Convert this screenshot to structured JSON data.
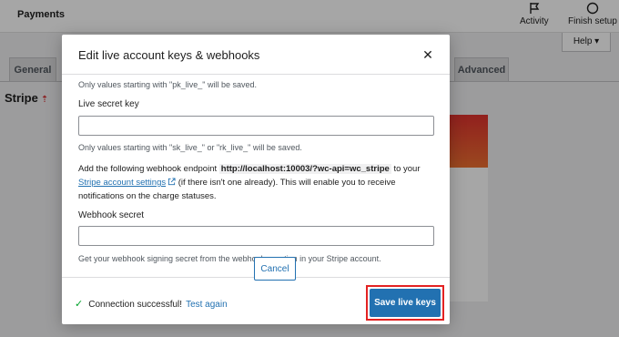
{
  "page": {
    "title": "Payments",
    "activity_label": "Activity",
    "finish_setup_label": "Finish setup",
    "help_label": "Help ▾",
    "tabs": [
      {
        "label": "General"
      },
      {
        "label": "Advanced"
      }
    ],
    "section_heading": "Stripe"
  },
  "modal": {
    "title": "Edit live account keys & webhooks",
    "publishable_hint": "Only values starting with \"pk_live_\" will be saved.",
    "secret_key_label": "Live secret key",
    "secret_key_value": "",
    "secret_key_hint": "Only values starting with \"sk_live_\" or \"rk_live_\" will be saved.",
    "webhook_text_before": "Add the following webhook endpoint",
    "webhook_endpoint": "http://localhost:10003/?wc-api=wc_stripe",
    "webhook_text_to_your": "to your",
    "stripe_settings_link": "Stripe account settings",
    "webhook_text_after": "(if there isn't one already). This will enable you to receive notifications on the charge statuses.",
    "webhook_secret_label": "Webhook secret",
    "webhook_secret_value": "",
    "webhook_secret_hint": "Get your webhook signing secret from the webhooks section in your Stripe account.",
    "status_text": "Connection successful!",
    "test_again_label": "Test again",
    "cancel_label": "Cancel",
    "save_label": "Save live keys"
  },
  "colors": {
    "accent": "#2271b1",
    "success": "#00a32a",
    "highlight": "#e32222"
  },
  "icons": {
    "activity": "flag-icon",
    "finish_setup": "circle-icon",
    "close": "close-icon",
    "external": "external-link-icon",
    "success": "checkmark-icon"
  }
}
